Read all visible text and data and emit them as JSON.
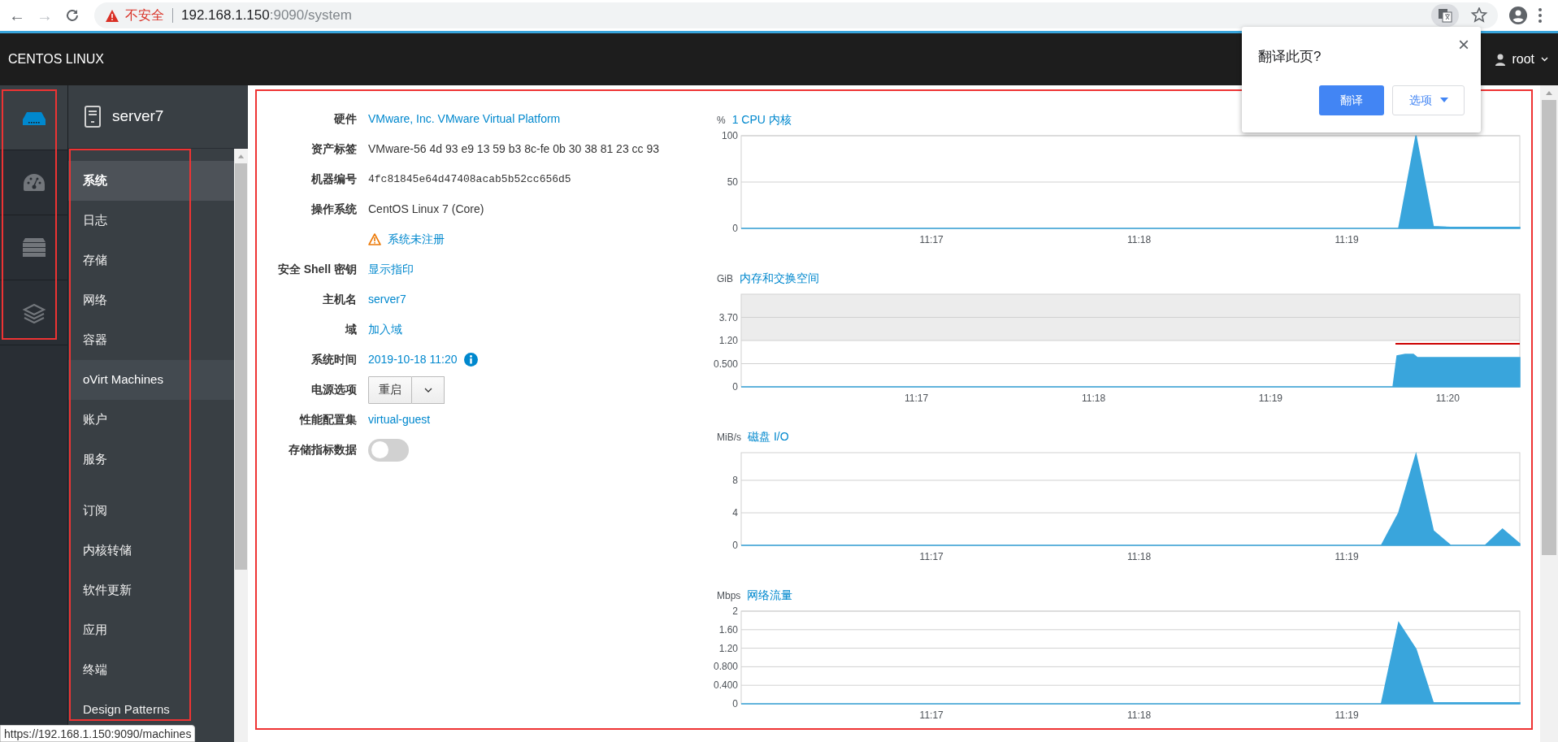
{
  "browser": {
    "back": "←",
    "forward": "→",
    "security_label": "不安全",
    "url_host": "192.168.1.150",
    "url_path": ":9090/system",
    "status_url": "https://192.168.1.150:9090/machines"
  },
  "header": {
    "brand": "CENTOS LINUX",
    "user": "root"
  },
  "translate_popup": {
    "title": "翻译此页?",
    "close": "×",
    "translate_button": "翻译",
    "options_button": "选项"
  },
  "icon_rail": [
    {
      "kind": "server",
      "selected": true
    },
    {
      "kind": "dashboard",
      "selected": false
    },
    {
      "kind": "rack",
      "selected": false
    },
    {
      "kind": "layers",
      "selected": false
    }
  ],
  "host": {
    "name": "server7"
  },
  "nav_groups": [
    {
      "items": [
        {
          "label": "系统",
          "selected": true,
          "hovered": false
        },
        {
          "label": "日志",
          "selected": false,
          "hovered": false
        },
        {
          "label": "存储",
          "selected": false,
          "hovered": false
        },
        {
          "label": "网络",
          "selected": false,
          "hovered": false
        },
        {
          "label": "容器",
          "selected": false,
          "hovered": false
        },
        {
          "label": "oVirt Machines",
          "selected": false,
          "hovered": true
        },
        {
          "label": "账户",
          "selected": false,
          "hovered": false
        },
        {
          "label": "服务",
          "selected": false,
          "hovered": false
        }
      ]
    },
    {
      "items": [
        {
          "label": "订阅",
          "selected": false,
          "hovered": false
        },
        {
          "label": "内核转储",
          "selected": false,
          "hovered": false
        },
        {
          "label": "软件更新",
          "selected": false,
          "hovered": false
        },
        {
          "label": "应用",
          "selected": false,
          "hovered": false
        },
        {
          "label": "终端",
          "selected": false,
          "hovered": false
        },
        {
          "label": "Design Patterns",
          "selected": false,
          "hovered": false
        }
      ]
    }
  ],
  "info_rows": [
    {
      "label": "硬件",
      "kind": "link",
      "value": "VMware, Inc. VMware Virtual Platform"
    },
    {
      "label": "资产标签",
      "kind": "text",
      "value": "VMware-56 4d 93 e9 13 59 b3 8c-fe 0b 30 38 81 23 cc 93"
    },
    {
      "label": "机器编号",
      "kind": "mono",
      "value": "4fc81845e64d47408acab5b52cc656d5"
    },
    {
      "label": "操作系统",
      "kind": "text",
      "value": "CentOS Linux 7 (Core)"
    },
    {
      "kind": "warning",
      "value": "系统未注册"
    },
    {
      "label": "安全 Shell 密钥",
      "kind": "link",
      "value": "显示指印"
    },
    {
      "label": "主机名",
      "kind": "link",
      "value": "server7"
    },
    {
      "label": "域",
      "kind": "link",
      "value": "加入域"
    },
    {
      "label": "系统时间",
      "kind": "link-info",
      "value": "2019-10-18 11:20"
    },
    {
      "label": "电源选项",
      "kind": "split-button",
      "value": "重启"
    },
    {
      "label": "性能配置集",
      "kind": "link",
      "value": "virtual-guest"
    },
    {
      "label": "存储指标数据",
      "kind": "toggle",
      "on": false
    }
  ],
  "charts": [
    {
      "kind": "plot",
      "chart_data": {
        "type": "area",
        "title": "1 CPU 内核",
        "ylabel": "%",
        "grid": true,
        "ylim": [
          0,
          100
        ],
        "yticks": [
          0,
          50,
          100
        ],
        "categories": [
          null,
          null,
          null,
          null,
          null,
          null,
          null,
          null,
          null,
          null,
          null,
          "11:17",
          null,
          null,
          null,
          null,
          null,
          null,
          null,
          null,
          null,
          null,
          null,
          "11:18",
          null,
          null,
          null,
          null,
          null,
          null,
          null,
          null,
          null,
          null,
          null,
          "11:19",
          null,
          null,
          null,
          null,
          null,
          null,
          null,
          null,
          null,
          null
        ],
        "series": [
          {
            "color": "#39a5dc",
            "values": [
              0,
              0,
              0,
              0,
              0,
              0,
              0,
              0,
              0,
              0,
              0,
              0,
              0,
              0,
              0,
              0,
              0,
              0,
              0,
              0,
              0,
              0,
              0,
              0,
              0,
              0,
              0,
              0,
              0,
              0,
              0,
              0,
              0,
              0,
              0,
              0,
              0,
              0,
              0,
              100,
              2,
              1,
              1,
              1,
              1,
              1
            ]
          }
        ]
      }
    },
    {
      "kind": "picture",
      "title": "内存和交换空间",
      "unit": "GiB",
      "y_labels": [
        "3.70",
        "1.20",
        "0.500",
        "0"
      ],
      "x_labels": [
        "11:17",
        "11:18",
        "11:19",
        "11:20"
      ]
    },
    {
      "kind": "plot",
      "chart_data": {
        "type": "area",
        "title": "磁盘 I/O",
        "ylabel": "MiB/s",
        "grid": true,
        "ylim": [
          0,
          11.4
        ],
        "yticks": [
          0,
          4,
          8
        ],
        "categories": [
          null,
          null,
          null,
          null,
          null,
          null,
          null,
          null,
          null,
          null,
          null,
          "11:17",
          null,
          null,
          null,
          null,
          null,
          null,
          null,
          null,
          null,
          null,
          null,
          "11:18",
          null,
          null,
          null,
          null,
          null,
          null,
          null,
          null,
          null,
          null,
          null,
          "11:19",
          null,
          null,
          null,
          null,
          null,
          null,
          null,
          null,
          null,
          null
        ],
        "series": [
          {
            "color": "#39a5dc",
            "values": [
              0,
              0,
              0,
              0,
              0,
              0,
              0,
              0,
              0,
              0,
              0,
              0,
              0,
              0,
              0,
              0,
              0,
              0,
              0,
              0,
              0,
              0,
              0,
              0,
              0,
              0,
              0,
              0,
              0,
              0,
              0,
              0,
              0,
              0,
              0,
              0,
              0,
              0,
              4,
              11.2,
              1.8,
              0,
              0,
              0,
              2,
              0.2
            ]
          }
        ]
      }
    },
    {
      "kind": "plot",
      "chart_data": {
        "type": "area",
        "title": "网络流量",
        "ylabel": "Mbps",
        "grid": true,
        "ylim": [
          0,
          2
        ],
        "yticks": [
          0,
          {
            "value": 0.4,
            "label": "0.400"
          },
          {
            "value": 0.8,
            "label": "0.800"
          },
          {
            "value": 1.2,
            "label": "1.20"
          },
          {
            "value": 1.6,
            "label": "1.60"
          },
          2
        ],
        "categories": [
          null,
          null,
          null,
          null,
          null,
          null,
          null,
          null,
          null,
          null,
          null,
          "11:17",
          null,
          null,
          null,
          null,
          null,
          null,
          null,
          null,
          null,
          null,
          null,
          "11:18",
          null,
          null,
          null,
          null,
          null,
          null,
          null,
          null,
          null,
          null,
          null,
          "11:19",
          null,
          null,
          null,
          null,
          null,
          null,
          null,
          null,
          null,
          null
        ],
        "series": [
          {
            "color": "#39a5dc",
            "values": [
              0,
              0,
              0,
              0,
              0,
              0,
              0,
              0,
              0,
              0,
              0,
              0,
              0,
              0,
              0,
              0,
              0,
              0,
              0,
              0,
              0,
              0,
              0,
              0,
              0,
              0,
              0,
              0,
              0,
              0,
              0,
              0,
              0,
              0,
              0,
              0,
              0,
              0,
              1.75,
              1.18,
              0.02,
              0.02,
              0.02,
              0.02,
              0.02,
              0.02
            ]
          }
        ]
      }
    }
  ]
}
